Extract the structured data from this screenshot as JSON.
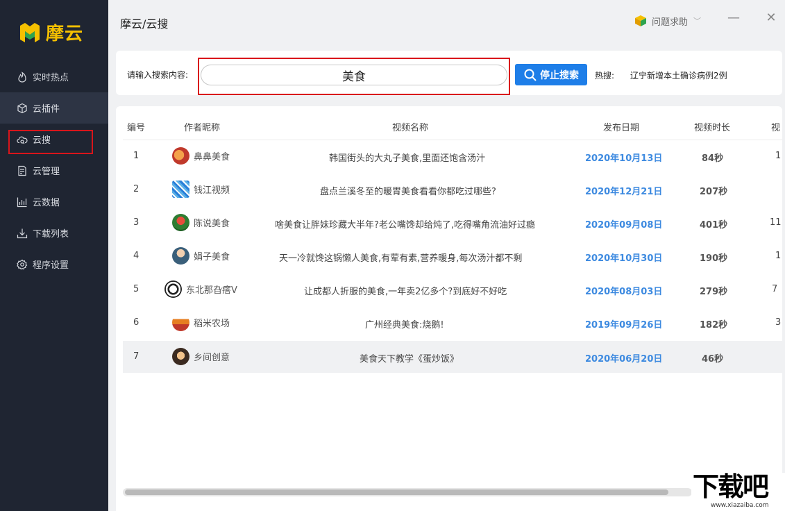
{
  "app": {
    "logo_text": "摩云",
    "page_title": "摩云/云搜"
  },
  "sidebar": {
    "items": [
      {
        "label": "实时热点",
        "icon": "flame-icon"
      },
      {
        "label": "云插件",
        "icon": "cube-icon"
      },
      {
        "label": "云搜",
        "icon": "cloud-search-icon"
      },
      {
        "label": "云管理",
        "icon": "document-icon"
      },
      {
        "label": "云数据",
        "icon": "bar-chart-icon"
      },
      {
        "label": "下载列表",
        "icon": "download-icon"
      },
      {
        "label": "程序设置",
        "icon": "gear-icon"
      }
    ]
  },
  "header": {
    "help_label": "问题求助",
    "minimize": "—",
    "close": "✕"
  },
  "search": {
    "label": "请输入搜索内容:",
    "value": "美食",
    "stop_label": "停止搜索",
    "hot_label": "热搜:",
    "hot_topic": "辽宁新增本土确诊病例2例"
  },
  "table": {
    "columns": [
      "编号",
      "作者昵称",
      "视频名称",
      "发布日期",
      "视频时长",
      "视"
    ],
    "rows": [
      {
        "num": "1",
        "author": "鼻鼻美食",
        "title": "韩国街头的大丸子美食,里面还饱含汤汁",
        "date": "2020年10月13日",
        "duration": "84秒",
        "extra": "1"
      },
      {
        "num": "2",
        "author": "钱江视频",
        "title": "盘点兰溪冬至的暖胃美食看看你都吃过哪些?",
        "date": "2020年12月21日",
        "duration": "207秒",
        "extra": ""
      },
      {
        "num": "3",
        "author": "陈说美食",
        "title": "啥美食让胖妹珍藏大半年?老公嘴馋却给炖了,吃得嘴角流油好过瘾",
        "date": "2020年09月08日",
        "duration": "401秒",
        "extra": "11"
      },
      {
        "num": "4",
        "author": "娟子美食",
        "title": "天一冷就馋这锅懒人美食,有荤有素,营养暖身,每次汤汁都不剩",
        "date": "2020年10月30日",
        "duration": "190秒",
        "extra": "1"
      },
      {
        "num": "5",
        "author": "东北那旮瘩V",
        "title": "让成都人折服的美食,一年卖2亿多个?到底好不好吃",
        "date": "2020年08月03日",
        "duration": "279秒",
        "extra": "7"
      },
      {
        "num": "6",
        "author": "稻米农场",
        "title": "广州经典美食:烧鹅!",
        "date": "2019年09月26日",
        "duration": "182秒",
        "extra": "3"
      },
      {
        "num": "7",
        "author": "乡间创意",
        "title": "美食天下教学《蛋炒饭》",
        "date": "2020年06月20日",
        "duration": "46秒",
        "extra": ""
      }
    ]
  },
  "watermark": {
    "big": "下载吧",
    "small": "www.xiazaiba.com"
  },
  "colors": {
    "sidebar_bg": "#1f2532",
    "accent": "#1e7ee8",
    "date": "#3d8ae0",
    "highlight": "#d9151b",
    "logo": "#f5c000"
  }
}
